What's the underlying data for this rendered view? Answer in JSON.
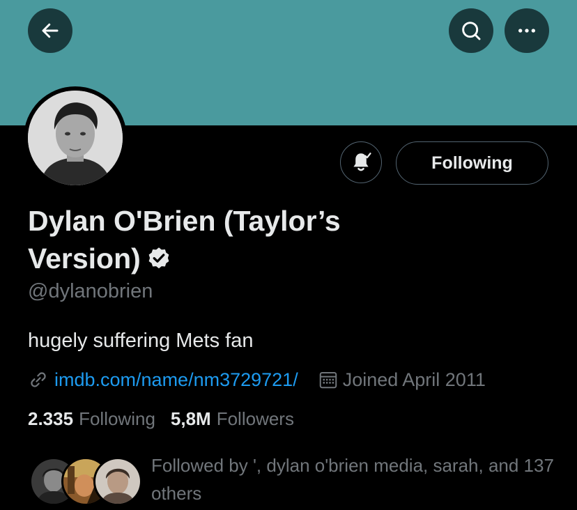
{
  "header": {
    "back_icon": "arrow-left-icon",
    "search_icon": "search-icon",
    "more_icon": "more-horizontal-icon",
    "banner_color": "#4a9a9e"
  },
  "profile": {
    "name": "Dylan O'Brien (Taylor’s Version)",
    "verified": true,
    "handle": "@dylanobrien",
    "bio": "hugely suffering Mets fan",
    "link": "imdb.com/name/nm3729721/",
    "joined": "Joined April 2011"
  },
  "actions": {
    "notifications_icon": "bell-check-icon",
    "following_label": "Following"
  },
  "stats": {
    "following_count": "2.335",
    "following_label": "Following",
    "followers_count": "5,8M",
    "followers_label": "Followers"
  },
  "followed_by": {
    "text": "Followed by ', dylan o'brien media, sarah, and 137 others"
  },
  "colors": {
    "link": "#1d9bf0",
    "muted": "#71767b",
    "text": "#e7e9ea",
    "background": "#000000"
  }
}
